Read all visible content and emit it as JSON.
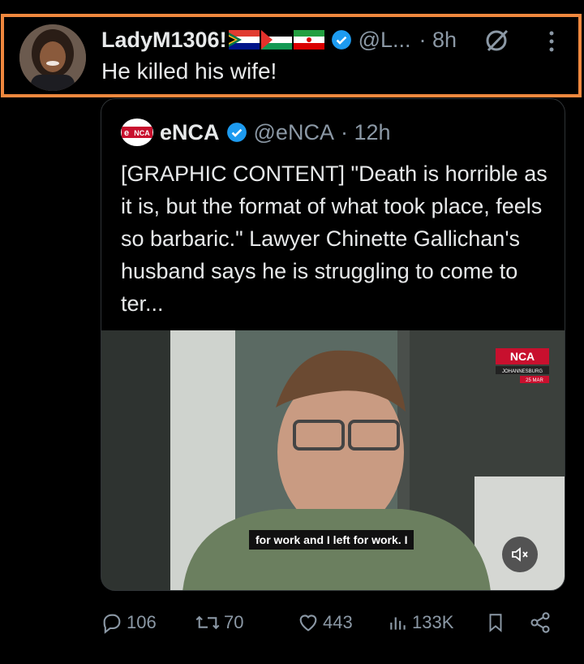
{
  "tweet": {
    "author_name": "LadyM1306!",
    "handle": "@L...",
    "time": "· 8h",
    "text": "He killed his wife!",
    "flags": [
      "south-africa-flag",
      "palestine-flag",
      "iran-flag"
    ]
  },
  "quoted": {
    "logo_text": "NCA",
    "author_name": "eNCA",
    "handle": "@eNCA",
    "time": "· 12h",
    "text": "[GRAPHIC CONTENT] \"Death is horrible as it is, but the format of what took place, feels so barbaric.\" Lawyer Chinette Gallichan's husband says he is struggling to come to ter...",
    "video": {
      "subtitle": "for work and I left for work. I",
      "badge_brand": "NCA",
      "badge_location": "JOHANNESBURG",
      "badge_date": "25 MAR"
    }
  },
  "actions": {
    "replies": "106",
    "reposts": "70",
    "likes": "443",
    "views": "133K"
  },
  "colors": {
    "highlight": "#f0883e",
    "verified": "#1d9bf0",
    "muted_text": "#8b98a5",
    "enca_red": "#c8102e"
  }
}
